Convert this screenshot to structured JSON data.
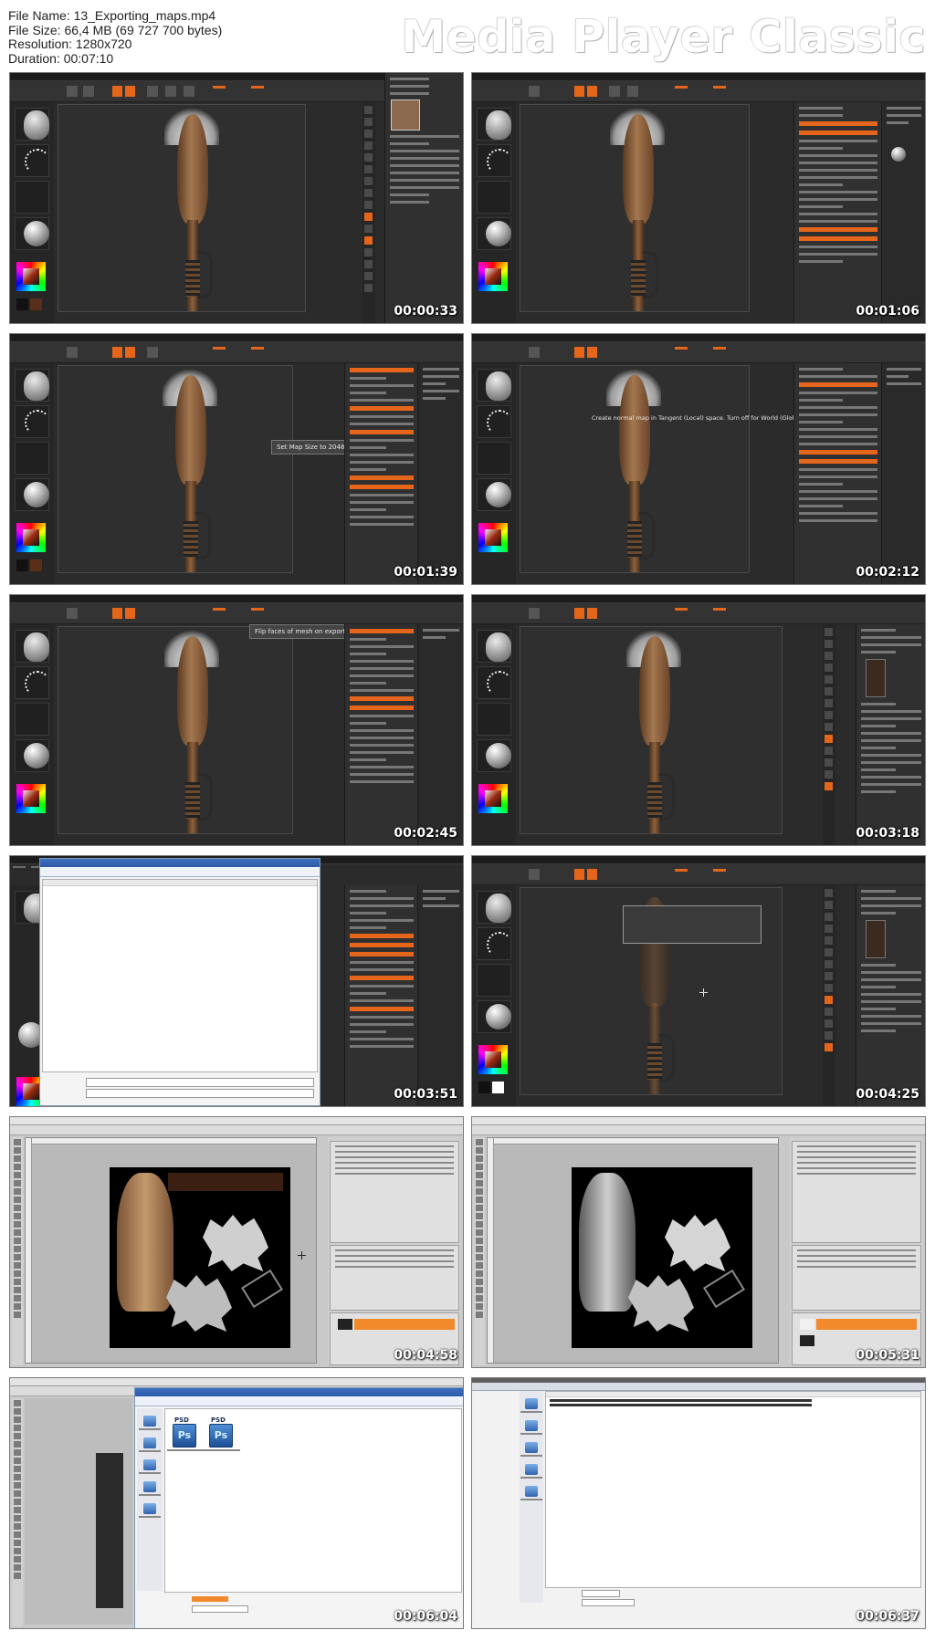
{
  "file_info": {
    "name_line": "File Name: 13_Exporting_maps.mp4",
    "size_line": "File Size: 66,4 MB (69 727 700 bytes)",
    "resolution_line": "Resolution: 1280x720",
    "duration_line": "Duration: 00:07:10"
  },
  "brand": "Media Player Classic",
  "thumbnails": [
    {
      "timestamp": "00:00:33",
      "scene": "zbrush-export-menu"
    },
    {
      "timestamp": "00:01:06",
      "scene": "zbrush-tool-panel"
    },
    {
      "timestamp": "00:01:39",
      "scene": "zbrush-map-size",
      "tooltip": "Set Map Size to 2048"
    },
    {
      "timestamp": "00:02:12",
      "scene": "zbrush-tangent",
      "tooltip": "Create normal map in Tangent (Local) space. Turn off for World (Global) space."
    },
    {
      "timestamp": "00:02:45",
      "scene": "zbrush-flip",
      "tooltip": "Flip faces of mesh on export."
    },
    {
      "timestamp": "00:03:18",
      "scene": "zbrush-subtools"
    },
    {
      "timestamp": "00:03:51",
      "scene": "zbrush-save-dialog"
    },
    {
      "timestamp": "00:04:25",
      "scene": "zbrush-maps-created"
    },
    {
      "timestamp": "00:04:58",
      "scene": "photoshop-color-map"
    },
    {
      "timestamp": "00:05:31",
      "scene": "photoshop-gray-map"
    },
    {
      "timestamp": "00:06:04",
      "scene": "photoshop-open-dialog"
    },
    {
      "timestamp": "00:06:37",
      "scene": "explorer-file-list"
    }
  ],
  "colors": {
    "zbrush_accent": "#e5661b",
    "zbrush_bg": "#2b2b2b",
    "photoshop_bg": "#c9c9c9",
    "psd_icon": "#2f6fbf"
  }
}
